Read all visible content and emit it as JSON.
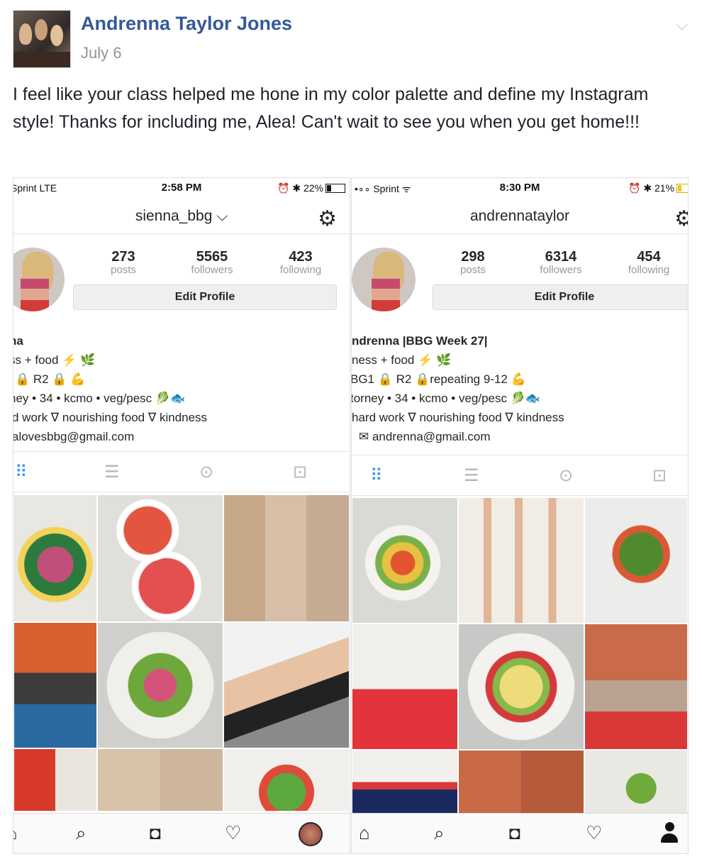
{
  "post": {
    "author": "Andrenna Taylor Jones",
    "date": "July 6",
    "text": "I feel like your class helped me hone in my color palette and define my Instagram style! Thanks for including me, Alea! Can't wait to see you when you get home!!!",
    "chevron_icon": "chevron-down-icon"
  },
  "screenshots": [
    {
      "status": {
        "carrier": "Sprint  LTE",
        "time": "2:58 PM",
        "battery": "22%",
        "battery_level": 0.22
      },
      "username": "sienna_bbg ⌵",
      "stats": {
        "posts_n": "273",
        "posts_l": "posts",
        "followers_n": "5565",
        "followers_l": "followers",
        "following_n": "423",
        "following_l": "following"
      },
      "edit_profile": "Edit Profile",
      "bio": [
        "na",
        "ss + food ⚡ 🌿",
        "🔒 R2 🔒 💪",
        "ney • 34 • kcmo • veg/pesc 🥬🐟",
        "d work ∇ nourishing food ∇ kindness",
        "alovesbbg@gmail.com"
      ]
    },
    {
      "status": {
        "carrier": "Sprint ᯤ",
        "time": "8:30 PM",
        "battery": "21%",
        "battery_level": 0.21
      },
      "username": "andrennataylor",
      "stats": {
        "posts_n": "298",
        "posts_l": "posts",
        "followers_n": "6314",
        "followers_l": "followers",
        "following_n": "454",
        "following_l": "following"
      },
      "edit_profile": "Edit Profile",
      "bio": [
        "ndrenna |BBG Week 27|",
        "ness + food ⚡ 🌿",
        "BG1 🔒 R2 🔒repeating 9-12 💪",
        "torney • 34 • kcmo • veg/pesc 🥬🐟",
        "hard work ∇ nourishing food ∇ kindness",
        "✉ andrenna@gmail.com"
      ]
    }
  ],
  "icons": {
    "gear": "gear-icon",
    "grid": "grid-icon",
    "list": "list-icon",
    "location": "location-pin-icon",
    "tagged": "tagged-photos-icon",
    "home": "home-icon",
    "search": "search-icon",
    "camera": "camera-icon",
    "heart": "heart-icon",
    "profile": "profile-icon"
  },
  "colors": {
    "link": "#365899",
    "accent": "#3897f0"
  }
}
